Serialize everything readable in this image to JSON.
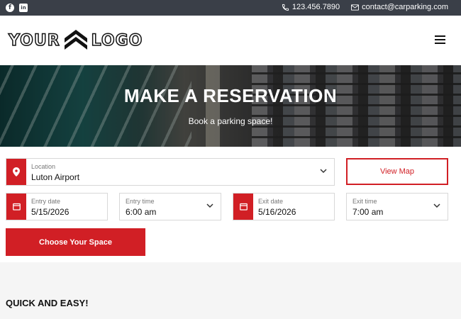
{
  "topbar": {
    "phone": "123.456.7890",
    "email": "contact@carparking.com",
    "social": [
      "facebook-icon",
      "linkedin-icon"
    ]
  },
  "header": {
    "logo_left": "YOUR",
    "logo_right": "LOGO"
  },
  "hero": {
    "title": "MAKE A RESERVATION",
    "subtitle": "Book a parking space!"
  },
  "form": {
    "location": {
      "label": "Location",
      "value": "Luton Airport"
    },
    "view_map_label": "View Map",
    "entry_date": {
      "label": "Entry date",
      "value": "5/15/2026"
    },
    "entry_time": {
      "label": "Entry time",
      "value": "6:00 am"
    },
    "exit_date": {
      "label": "Exit date",
      "value": "5/16/2026"
    },
    "exit_time": {
      "label": "Exit time",
      "value": "7:00 am"
    },
    "submit_label": "Choose Your Space"
  },
  "section": {
    "title": "QUICK AND EASY!"
  },
  "colors": {
    "accent": "#d11f25",
    "topbar": "#3a3f48"
  }
}
